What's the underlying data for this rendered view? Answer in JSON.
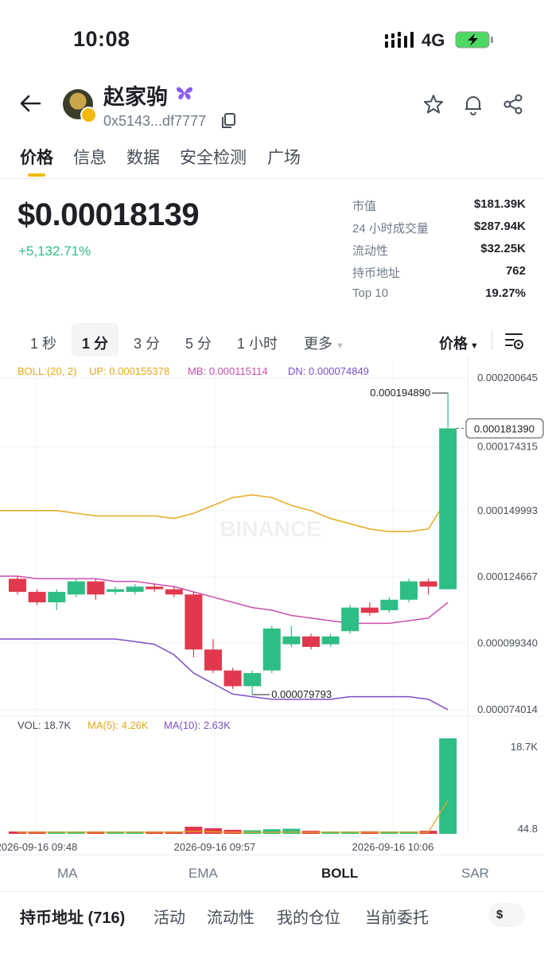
{
  "status": {
    "time": "10:08",
    "network": "4G"
  },
  "token": {
    "name": "赵家驹",
    "address": "0x5143...df7777"
  },
  "tabs": [
    "价格",
    "信息",
    "数据",
    "安全检测",
    "广场"
  ],
  "price": {
    "value": "$0.00018139",
    "change": "+5,132.71%"
  },
  "stats": [
    {
      "label": "市值",
      "value": "$181.39K"
    },
    {
      "label": "24 小时成交量",
      "value": "$287.94K"
    },
    {
      "label": "流动性",
      "value": "$32.25K"
    },
    {
      "label": "持币地址",
      "value": "762"
    },
    {
      "label": "Top 10",
      "value": "19.27%"
    }
  ],
  "intervals": [
    "1 秒",
    "1 分",
    "3 分",
    "5 分",
    "1 小时",
    "更多"
  ],
  "interval_active": "1 分",
  "price_toggle": "价格",
  "chart_data": {
    "type": "candlestick",
    "boll": {
      "label": "BOLL:(20, 2)",
      "up": "UP: 0.000155378",
      "mb": "MB: 0.000115114",
      "dn": "DN: 0.000074849"
    },
    "price_axis": [
      "0.000200645",
      "0.000174315",
      "0.000149993",
      "0.000124667",
      "0.000099340",
      "0.000074014"
    ],
    "current_price_label": "0.000181390",
    "high_label": "0.000194890",
    "low_label": "0.000079793",
    "watermark": "BINANCE",
    "candles": [
      {
        "o": 0.000124,
        "c": 0.000119,
        "h": 0.000125,
        "l": 0.000118
      },
      {
        "o": 0.000119,
        "c": 0.000115,
        "h": 0.00012,
        "l": 0.000114
      },
      {
        "o": 0.000115,
        "c": 0.000119,
        "h": 0.00012,
        "l": 0.000112
      },
      {
        "o": 0.000118,
        "c": 0.000123,
        "h": 0.000124,
        "l": 0.000117
      },
      {
        "o": 0.000123,
        "c": 0.000118,
        "h": 0.000124,
        "l": 0.000116
      },
      {
        "o": 0.000119,
        "c": 0.00012,
        "h": 0.000121,
        "l": 0.000118
      },
      {
        "o": 0.000119,
        "c": 0.000121,
        "h": 0.000122,
        "l": 0.000118
      },
      {
        "o": 0.000121,
        "c": 0.00012,
        "h": 0.000122,
        "l": 0.000119
      },
      {
        "o": 0.00012,
        "c": 0.000118,
        "h": 0.000121,
        "l": 0.000117
      },
      {
        "o": 0.000118,
        "c": 9.7e-05,
        "h": 0.000119,
        "l": 9.4e-05
      },
      {
        "o": 9.7e-05,
        "c": 8.9e-05,
        "h": 0.000101,
        "l": 8.8e-05
      },
      {
        "o": 8.9e-05,
        "c": 8.3e-05,
        "h": 9e-05,
        "l": 8.2e-05
      },
      {
        "o": 8.3e-05,
        "c": 8.8e-05,
        "h": 8.9e-05,
        "l": 7.9793e-05
      },
      {
        "o": 8.9e-05,
        "c": 0.000105,
        "h": 0.000106,
        "l": 8.8e-05
      },
      {
        "o": 9.9e-05,
        "c": 0.000102,
        "h": 0.000106,
        "l": 9.8e-05
      },
      {
        "o": 0.000102,
        "c": 9.8e-05,
        "h": 0.000103,
        "l": 9.7e-05
      },
      {
        "o": 9.9e-05,
        "c": 0.000102,
        "h": 0.000103,
        "l": 9.8e-05
      },
      {
        "o": 0.000104,
        "c": 0.000113,
        "h": 0.000114,
        "l": 0.000103
      },
      {
        "o": 0.000113,
        "c": 0.000111,
        "h": 0.000115,
        "l": 0.00011
      },
      {
        "o": 0.000112,
        "c": 0.000116,
        "h": 0.000117,
        "l": 0.000111
      },
      {
        "o": 0.000116,
        "c": 0.000123,
        "h": 0.000124,
        "l": 0.000115
      },
      {
        "o": 0.000123,
        "c": 0.000121,
        "h": 0.000124,
        "l": 0.000118
      },
      {
        "o": 0.00012,
        "c": 0.00018139,
        "h": 0.00019489,
        "l": 0.00012
      }
    ],
    "boll_up": [
      0.00015,
      0.00015,
      0.00015,
      0.000149,
      0.000148,
      0.000148,
      0.000148,
      0.000148,
      0.000147,
      0.000149,
      0.000152,
      0.000155,
      0.000156,
      0.000155,
      0.000152,
      0.00015,
      0.000147,
      0.000145,
      0.000143,
      0.000142,
      0.000142,
      0.000143,
      0.000155
    ],
    "boll_mb": [
      0.000125,
      0.000124,
      0.000124,
      0.000124,
      0.000124,
      0.000123,
      0.000123,
      0.000122,
      0.000121,
      0.000119,
      0.000117,
      0.000115,
      0.000113,
      0.000112,
      0.00011,
      0.000109,
      0.000108,
      0.000107,
      0.000107,
      0.000107,
      0.000108,
      0.000109,
      0.000115
    ],
    "boll_dn": [
      0.000101,
      0.000101,
      0.000101,
      0.000101,
      0.000101,
      0.000101,
      0.0001,
      9.9e-05,
      9.5e-05,
      8.8e-05,
      8.4e-05,
      8e-05,
      7.9e-05,
      7.8e-05,
      7.8e-05,
      7.8e-05,
      7.8e-05,
      7.9e-05,
      7.9e-05,
      7.9e-05,
      7.9e-05,
      7.8e-05,
      7.4e-05
    ],
    "vol_label": "VOL: 18.7K",
    "vol_ma5": "MA(5): 4.26K",
    "vol_ma10": "MA(10): 2.63K",
    "vol_axis": [
      "18.7K",
      "44.8"
    ],
    "volumes": [
      200,
      150,
      100,
      180,
      160,
      90,
      80,
      110,
      140,
      1400,
      1100,
      800,
      700,
      900,
      1000,
      600,
      300,
      450,
      500,
      350,
      400,
      600,
      18700
    ],
    "time_labels": [
      "2026-09-16 09:48",
      "2026-09-16 09:57",
      "2026-09-16 10:06"
    ]
  },
  "indicators": [
    "MA",
    "EMA",
    "BOLL",
    "SAR"
  ],
  "indicator_active": "BOLL",
  "bottom_tabs": [
    "持币地址 (716)",
    "活动",
    "流动性",
    "我的仓位",
    "当前委托"
  ],
  "currency": "$",
  "colors": {
    "up": "#2ebd85",
    "down": "#e0394e",
    "accent": "#f0b90b",
    "boll_up": "#e6a81a",
    "boll_mb": "#c94fb0",
    "boll_dn": "#7a4fc4"
  }
}
